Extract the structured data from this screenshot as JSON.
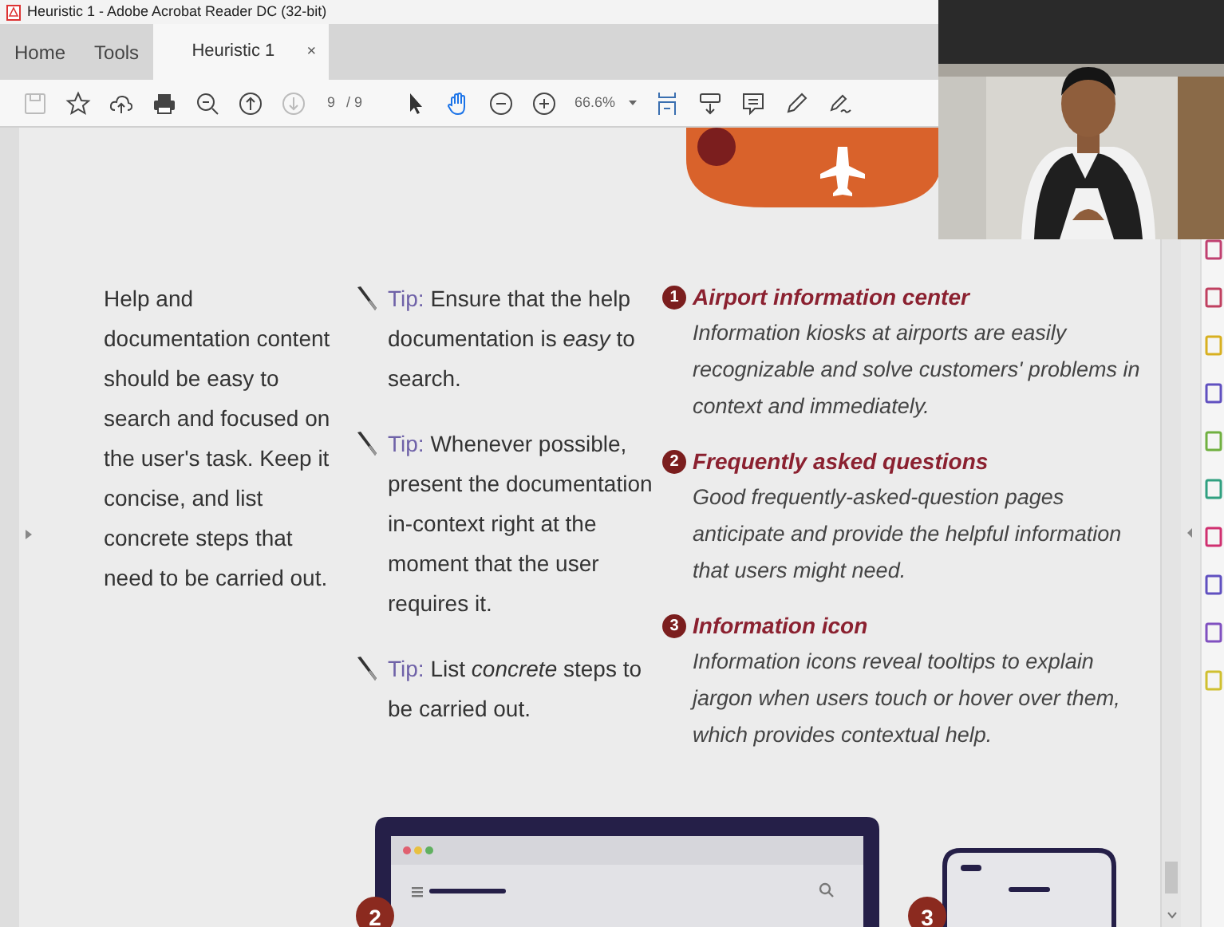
{
  "window": {
    "title": "Heuristic 1 - Adobe Acrobat Reader DC (32-bit)"
  },
  "tabs": [
    {
      "label": "Home",
      "selected": false
    },
    {
      "label": "Tools",
      "selected": false
    },
    {
      "label": "Heuristic 1",
      "selected": true,
      "close": "×"
    }
  ],
  "toolbar": {
    "save_disabled": true,
    "next_page_disabled": true,
    "page": "9",
    "page_count": "/ 9",
    "hand_tool_selected": true,
    "zoom": "66.6%"
  },
  "intro": "Help and documentation content should be easy to search and focused on the user's task. Keep it concise, and list concrete steps that need to be carried out.",
  "tips": [
    {
      "label": "Tip:",
      "text": "Ensure that the help documentation is *easy* to search."
    },
    {
      "label": "Tip:",
      "text": "Whenever possible, present the documentation in-context right at the moment that the user requires it."
    },
    {
      "label": "Tip:",
      "text": "List *concrete* steps to be carried out."
    }
  ],
  "examples": [
    {
      "number": "1",
      "title": "Airport information center",
      "text": "Information kiosks at airports are easily recognizable and solve customers' problems in context and immediately."
    },
    {
      "number": "2",
      "title": "Frequently asked questions",
      "text": "Good frequently-asked-question pages anticipate and provide the helpful information that users might need."
    },
    {
      "number": "3",
      "title": "Information icon",
      "text": "Information icons reveal tooltips to explain jargon when users touch or hover over them, which provides contextual help."
    }
  ],
  "illustration_badges": [
    "2",
    "3"
  ]
}
